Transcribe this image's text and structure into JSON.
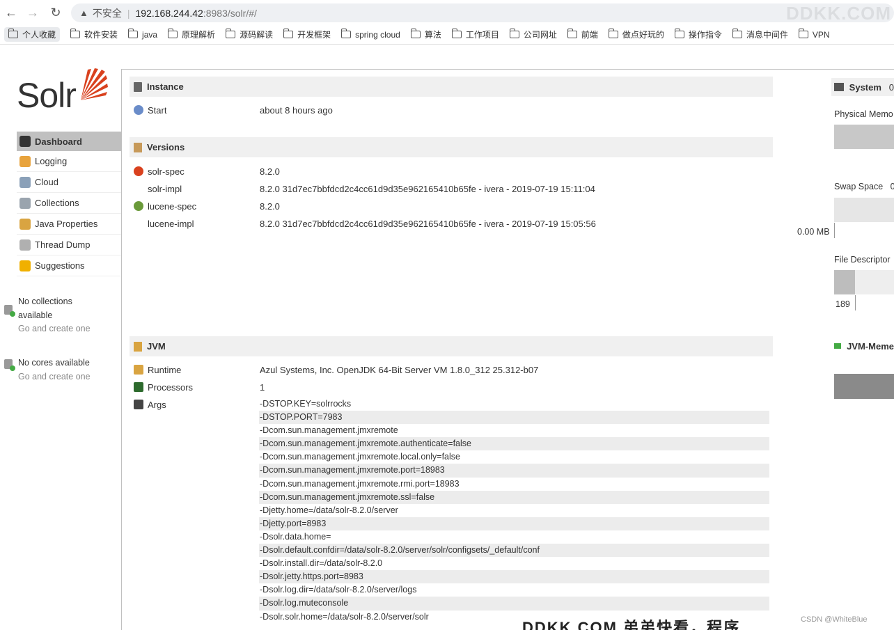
{
  "browser": {
    "security_label": "不安全",
    "url_host": "192.168.244.42",
    "url_path": ":8983/solr/#/",
    "watermark": "DDKK.COM"
  },
  "bookmarks": [
    "个人收藏",
    "软件安装",
    "java",
    "原理解析",
    "源码解读",
    "开发框架",
    "spring cloud",
    "算法",
    "工作项目",
    "公司网址",
    "前端",
    "做点好玩的",
    "操作指令",
    "消息中间件",
    "VPN"
  ],
  "logo": {
    "text": "Solr"
  },
  "sidebar": {
    "items": [
      {
        "label": "Dashboard",
        "icon": "dashboard-icon",
        "color": "#333333"
      },
      {
        "label": "Logging",
        "icon": "logging-icon",
        "color": "#e8a33c"
      },
      {
        "label": "Cloud",
        "icon": "cloud-icon",
        "color": "#8aa0b8"
      },
      {
        "label": "Collections",
        "icon": "collections-icon",
        "color": "#9aa4ae"
      },
      {
        "label": "Java Properties",
        "icon": "java-icon",
        "color": "#d9a441"
      },
      {
        "label": "Thread Dump",
        "icon": "thread-dump-icon",
        "color": "#b0b0b0"
      },
      {
        "label": "Suggestions",
        "icon": "bulb-icon",
        "color": "#f0b000"
      }
    ],
    "no_collections_line1": "No collections",
    "no_collections_line2": "available",
    "go_create_1": "Go and create one",
    "no_cores": "No cores available",
    "go_create_2": "Go and create one"
  },
  "instance": {
    "title": "Instance",
    "start_label": "Start",
    "start_value": "about 8 hours ago"
  },
  "versions": {
    "title": "Versions",
    "rows": [
      {
        "label": "solr-spec",
        "value": "8.2.0"
      },
      {
        "label": "solr-impl",
        "value": "8.2.0 31d7ec7bbfdcd2c4cc61d9d35e962165410b65fe - ivera - 2019-07-19 15:11:04"
      },
      {
        "label": "lucene-spec",
        "value": "8.2.0"
      },
      {
        "label": "lucene-impl",
        "value": "8.2.0 31d7ec7bbfdcd2c4cc61d9d35e962165410b65fe - ivera - 2019-07-19 15:05:56"
      }
    ]
  },
  "jvm": {
    "title": "JVM",
    "runtime_label": "Runtime",
    "runtime_value": "Azul Systems, Inc. OpenJDK 64-Bit Server VM 1.8.0_312 25.312-b07",
    "processors_label": "Processors",
    "processors_value": "1",
    "args_label": "Args",
    "args": [
      "-DSTOP.KEY=solrrocks",
      "-DSTOP.PORT=7983",
      "-Dcom.sun.management.jmxremote",
      "-Dcom.sun.management.jmxremote.authenticate=false",
      "-Dcom.sun.management.jmxremote.local.only=false",
      "-Dcom.sun.management.jmxremote.port=18983",
      "-Dcom.sun.management.jmxremote.rmi.port=18983",
      "-Dcom.sun.management.jmxremote.ssl=false",
      "-Djetty.home=/data/solr-8.2.0/server",
      "-Djetty.port=8983",
      "-Dsolr.data.home=",
      "-Dsolr.default.confdir=/data/solr-8.2.0/server/solr/configsets/_default/conf",
      "-Dsolr.install.dir=/data/solr-8.2.0",
      "-Dsolr.jetty.https.port=8983",
      "-Dsolr.log.dir=/data/solr-8.2.0/server/logs",
      "-Dsolr.log.muteconsole",
      "-Dsolr.solr.home=/data/solr-8.2.0/server/solr"
    ]
  },
  "system": {
    "title": "System",
    "title_suffix": "0",
    "physical_memory_label": "Physical Memo",
    "swap_space_label": "Swap Space",
    "swap_suffix": "0",
    "swap_value": "0.00 MB",
    "file_descriptor_label": "File Descriptor",
    "file_descriptor_value": "189",
    "jvm_memory_title": "JVM-Meme"
  },
  "footer_watermark": "DDKK.COM 弟弟快看，程序",
  "footer_watermark2": "CSDN @WhiteBlue"
}
